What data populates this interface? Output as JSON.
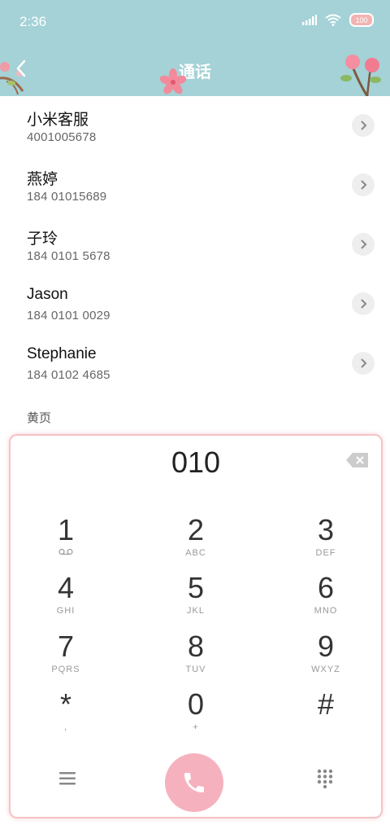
{
  "status": {
    "time": "2:36",
    "battery": "100"
  },
  "header": {
    "title": "通话"
  },
  "contacts": [
    {
      "name": "小米客服",
      "number": "4001005678"
    },
    {
      "name": "燕婷",
      "number": "184 01015689"
    },
    {
      "name": "子玲",
      "number": "184 0101 5678"
    },
    {
      "name": "Jason",
      "number": "184 0101 0029"
    },
    {
      "name": "Stephanie",
      "number": "184 0102 4685"
    }
  ],
  "section_label": "黄页",
  "dialpad": {
    "input": "010",
    "keys": [
      {
        "num": "1",
        "sub": "voicemail-icon"
      },
      {
        "num": "2",
        "sub": "ABC"
      },
      {
        "num": "3",
        "sub": "DEF"
      },
      {
        "num": "4",
        "sub": "GHI"
      },
      {
        "num": "5",
        "sub": "JKL"
      },
      {
        "num": "6",
        "sub": "MNO"
      },
      {
        "num": "7",
        "sub": "PQRS"
      },
      {
        "num": "8",
        "sub": "TUV"
      },
      {
        "num": "9",
        "sub": "WXYZ"
      },
      {
        "num": "*",
        "sub": ","
      },
      {
        "num": "0",
        "sub": "+"
      },
      {
        "num": "#",
        "sub": ""
      }
    ]
  },
  "colors": {
    "header_bg": "#a4d2d6",
    "call_button": "#f6b1bf",
    "dialpad_border": "#f6c3c6"
  }
}
